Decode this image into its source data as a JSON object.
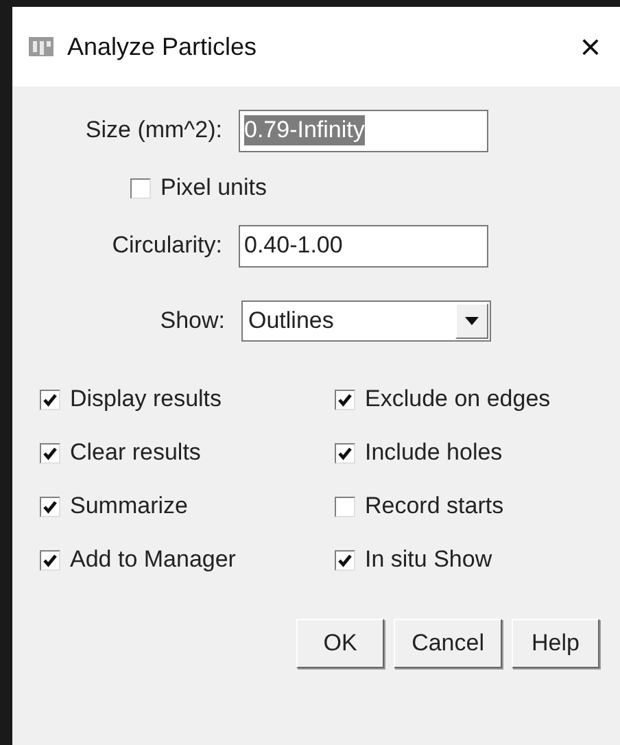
{
  "window": {
    "title": "Analyze Particles",
    "close": "×"
  },
  "fields": [
    {
      "label": "Size (mm^2):",
      "value": "0.79-Infinity",
      "text_selected": true
    },
    {
      "label": "Circularity:",
      "value": "0.40-1.00",
      "text_selected": false
    }
  ],
  "pixel_units": {
    "label": "Pixel units",
    "checked": false
  },
  "show": {
    "label": "Show:",
    "value": "Outlines"
  },
  "options": [
    {
      "label": "Display results",
      "checked": true
    },
    {
      "label": "Exclude on edges",
      "checked": true
    },
    {
      "label": "Clear results",
      "checked": true
    },
    {
      "label": "Include holes",
      "checked": true
    },
    {
      "label": "Summarize",
      "checked": true
    },
    {
      "label": "Record starts",
      "checked": false
    },
    {
      "label": "Add to Manager",
      "checked": true
    },
    {
      "label": "In situ Show",
      "checked": true
    }
  ],
  "buttons": [
    "OK",
    "Cancel",
    "Help"
  ]
}
